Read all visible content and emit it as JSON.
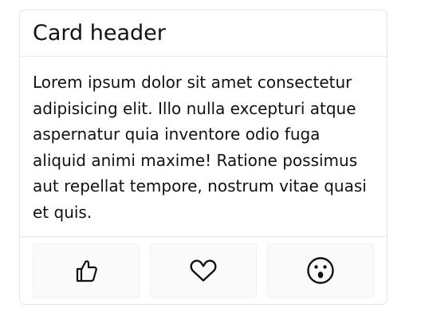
{
  "card": {
    "header": {
      "title": "Card header"
    },
    "body": {
      "text": "Lorem ipsum dolor sit amet consectetur adipisicing elit. Illo nulla excepturi atque aspernatur quia inventore odio fuga aliquid animi maxime! Ratione possimus aut repellat tempore, nostrum vitae quasi et quis."
    },
    "footer": {
      "actions": [
        {
          "icon": "thumbs-up-icon"
        },
        {
          "icon": "heart-icon"
        },
        {
          "icon": "surprised-face-icon"
        }
      ]
    }
  }
}
